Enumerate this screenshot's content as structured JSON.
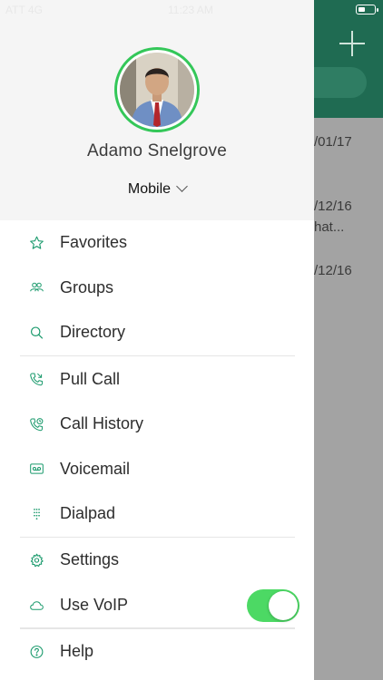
{
  "status_bar": {
    "carrier": "ATT 4G",
    "time": "11:23 AM"
  },
  "background": {
    "rows": [
      "/01/17",
      "/12/16",
      "hat...",
      "/12/16"
    ]
  },
  "profile": {
    "name": "Adamo Snelgrove",
    "mode": "Mobile"
  },
  "menu": {
    "favorites": "Favorites",
    "groups": "Groups",
    "directory": "Directory",
    "pull_call": "Pull Call",
    "call_history": "Call History",
    "voicemail": "Voicemail",
    "dialpad": "Dialpad",
    "settings": "Settings",
    "use_voip": "Use VoIP",
    "help": "Help"
  },
  "voip_enabled": true,
  "colors": {
    "accent": "#1a9a6c",
    "toggle_on": "#4cd964",
    "avatar_ring": "#34c759"
  }
}
